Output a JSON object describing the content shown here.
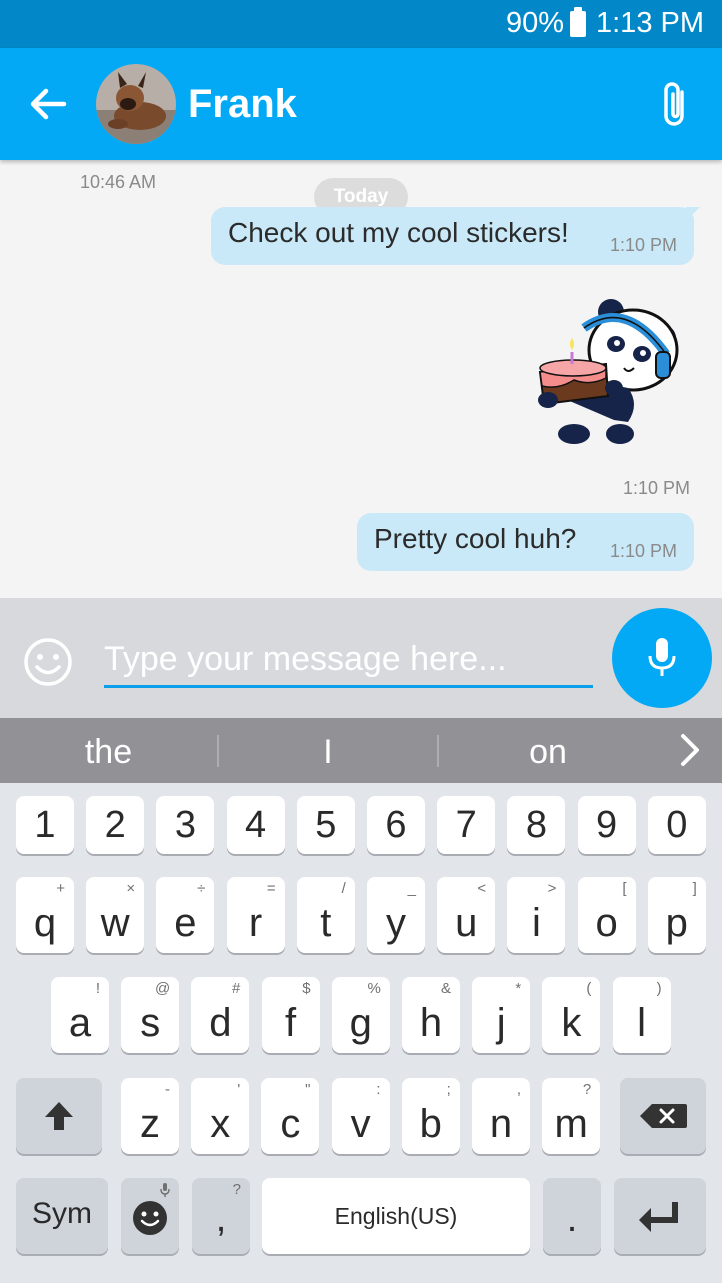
{
  "status_bar": {
    "battery": "90%",
    "time": "1:13 PM"
  },
  "header": {
    "contact_name": "Frank"
  },
  "conversation": {
    "earlier_timestamp": "10:46 AM",
    "date_separator": "Today",
    "messages": [
      {
        "text": "Check out my cool stickers!",
        "time": "1:10 PM"
      },
      {
        "type": "sticker",
        "sticker": "panda-with-birthday-cake",
        "time": "1:10 PM"
      },
      {
        "text": "Pretty cool huh?",
        "time": "1:10 PM"
      }
    ]
  },
  "composer": {
    "placeholder": "Type your message here..."
  },
  "suggestions": [
    "the",
    "I",
    "on"
  ],
  "keyboard": {
    "numbers": [
      "1",
      "2",
      "3",
      "4",
      "5",
      "6",
      "7",
      "8",
      "9",
      "0"
    ],
    "row1": [
      {
        "key": "q",
        "sub": "+"
      },
      {
        "key": "w",
        "sub": "×"
      },
      {
        "key": "e",
        "sub": "÷"
      },
      {
        "key": "r",
        "sub": "="
      },
      {
        "key": "t",
        "sub": "/"
      },
      {
        "key": "y",
        "sub": "_"
      },
      {
        "key": "u",
        "sub": "<"
      },
      {
        "key": "i",
        "sub": ">"
      },
      {
        "key": "o",
        "sub": "["
      },
      {
        "key": "p",
        "sub": "]"
      }
    ],
    "row2": [
      {
        "key": "a",
        "sub": "!"
      },
      {
        "key": "s",
        "sub": "@"
      },
      {
        "key": "d",
        "sub": "#"
      },
      {
        "key": "f",
        "sub": "$"
      },
      {
        "key": "g",
        "sub": "%"
      },
      {
        "key": "h",
        "sub": "&"
      },
      {
        "key": "j",
        "sub": "*"
      },
      {
        "key": "k",
        "sub": "("
      },
      {
        "key": "l",
        "sub": ")"
      }
    ],
    "row3": [
      {
        "key": "z",
        "sub": "-"
      },
      {
        "key": "x",
        "sub": "'"
      },
      {
        "key": "c",
        "sub": "\""
      },
      {
        "key": "v",
        "sub": ":"
      },
      {
        "key": "b",
        "sub": ";"
      },
      {
        "key": "n",
        "sub": ","
      },
      {
        "key": "m",
        "sub": "?"
      }
    ],
    "sym_label": "Sym",
    "comma": {
      "key": ",",
      "sub": "?"
    },
    "space_label": "English(US)",
    "period": "."
  },
  "colors": {
    "header": "#03a9f4",
    "status_bar": "#0288c9",
    "bubble": "#c9e9f8",
    "input_underline": "#0a9fe8"
  }
}
